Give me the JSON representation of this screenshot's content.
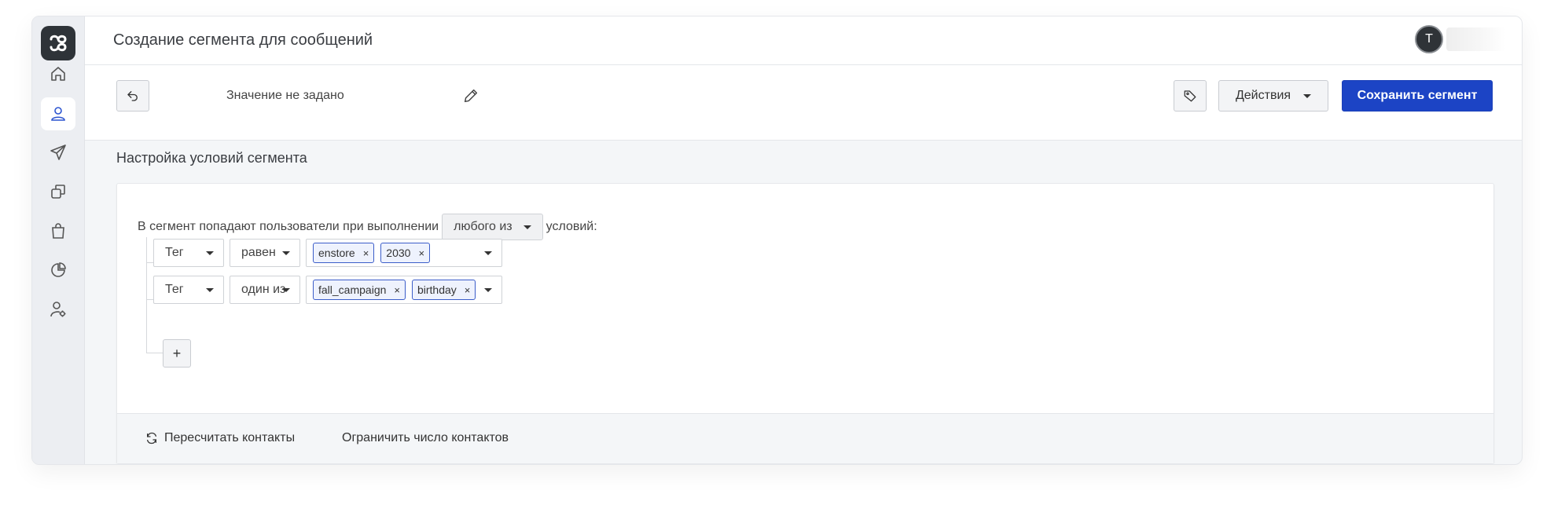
{
  "header": {
    "title": "Создание сегмента для сообщений",
    "avatar_initial": "T"
  },
  "sidebar": {
    "items": [
      {
        "icon": "home-icon"
      },
      {
        "icon": "user-icon",
        "active": true
      },
      {
        "icon": "send-icon"
      },
      {
        "icon": "copy-icon"
      },
      {
        "icon": "shopping-bag-icon"
      },
      {
        "icon": "pie-chart-icon"
      },
      {
        "icon": "user-settings-icon"
      }
    ]
  },
  "toolbar": {
    "segment_name": "Значение не задано",
    "actions_label": "Действия",
    "save_label": "Сохранить сегмент"
  },
  "conditions": {
    "section_title": "Настройка условий сегмента",
    "intro_before": "В сегмент попадают пользователи при выполнении",
    "match_mode": "любого из",
    "intro_after": "условий:",
    "rules": [
      {
        "field": "Тег",
        "operator": "равен",
        "values": [
          "enstore",
          "2030"
        ]
      },
      {
        "field": "Тег",
        "operator": "один из",
        "values": [
          "fall_campaign",
          "birthday"
        ]
      }
    ],
    "add_label": "+"
  },
  "footer": {
    "recalc_label": "Пересчитать контакты",
    "limit_label": "Ограничить число контактов"
  },
  "colors": {
    "primary": "#1c44c5",
    "chip_border": "#3b5dc9",
    "logo_bg": "#2e3338"
  }
}
